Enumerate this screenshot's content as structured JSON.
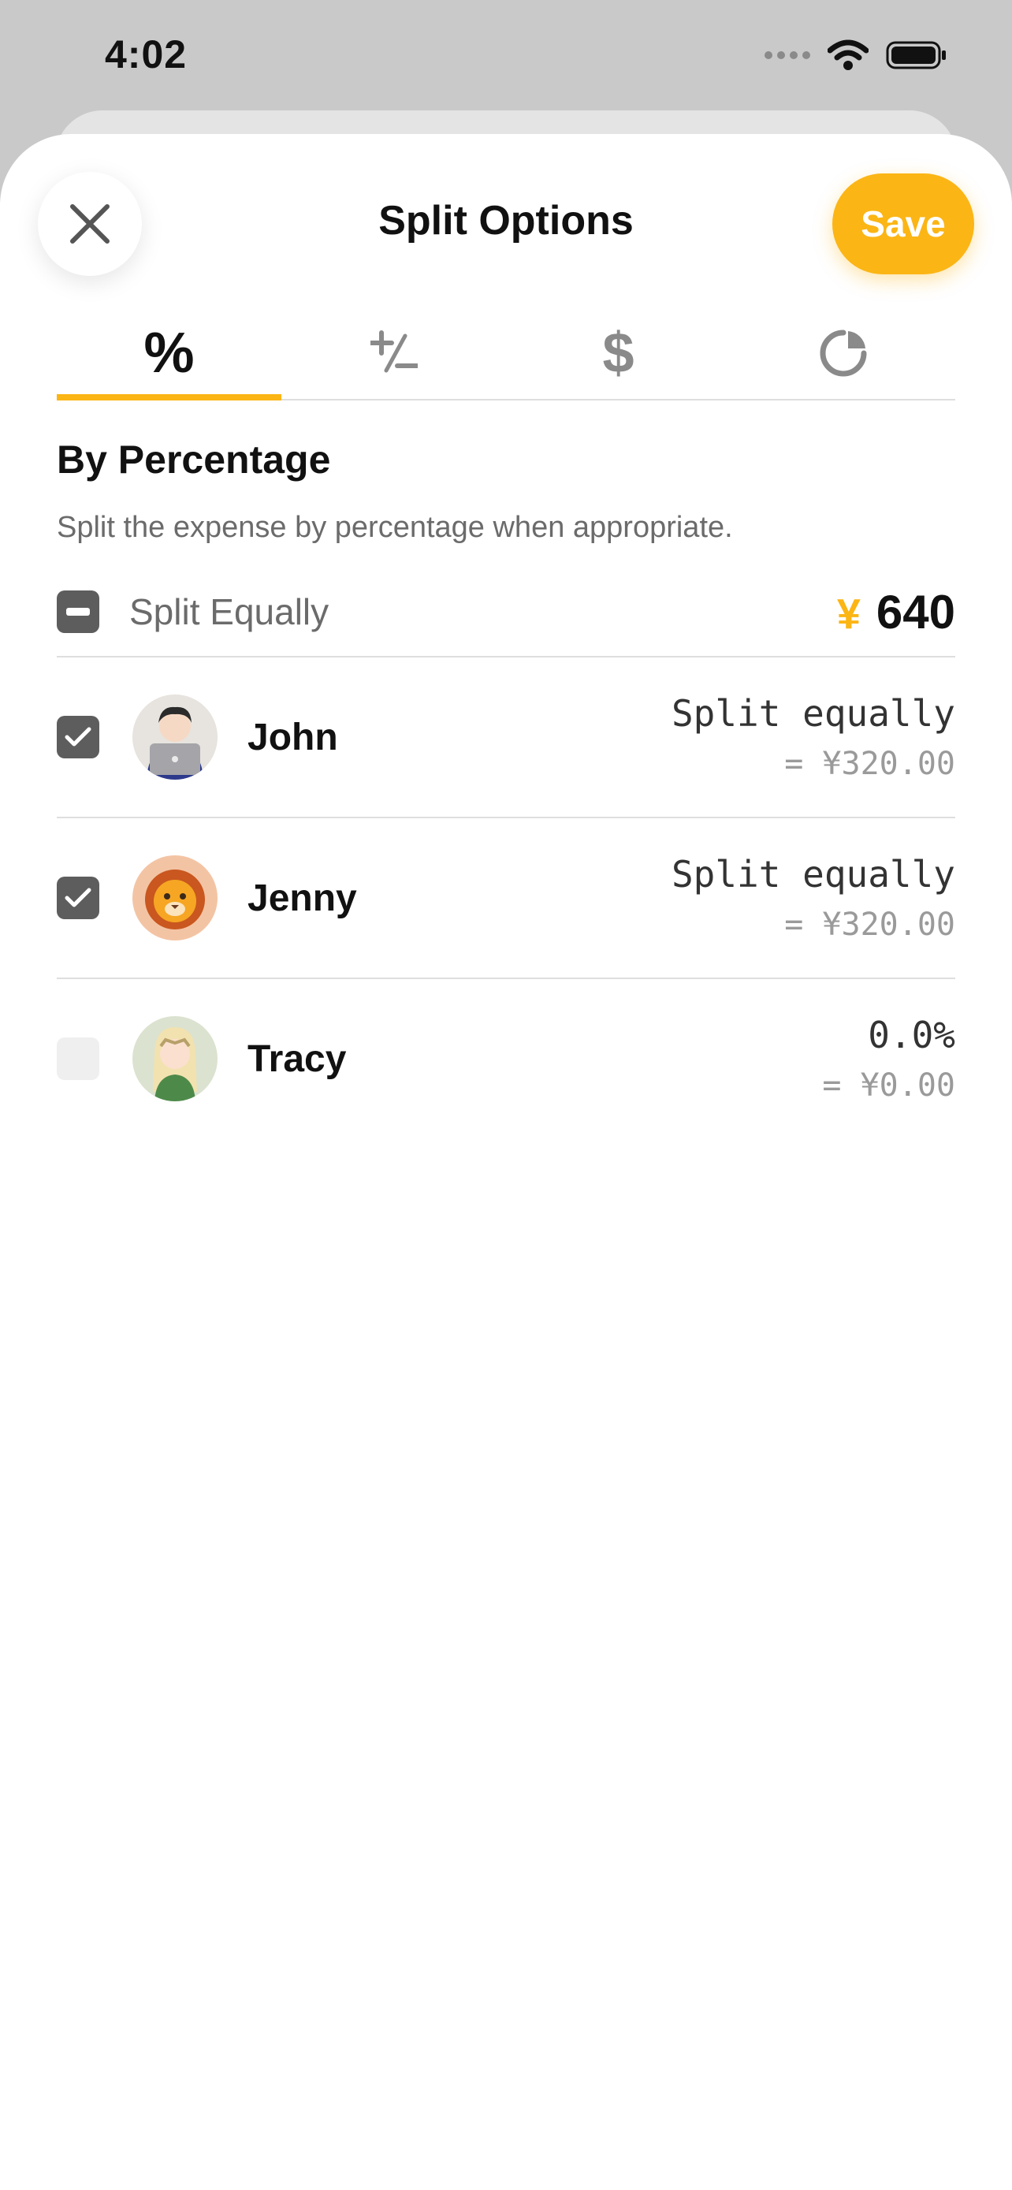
{
  "status_bar": {
    "time": "4:02"
  },
  "header": {
    "title": "Split Options",
    "save_label": "Save"
  },
  "tabs": [
    {
      "label": "%",
      "name": "percent"
    },
    {
      "label": "+/−",
      "name": "plus-minus"
    },
    {
      "label": "$",
      "name": "dollar"
    },
    {
      "label": "",
      "name": "pie"
    }
  ],
  "section": {
    "title": "By Percentage",
    "description": "Split the expense by percentage when appropriate."
  },
  "split_all": {
    "label": "Split Equally",
    "currency": "¥",
    "amount": "640"
  },
  "people": [
    {
      "name": "John",
      "primary": "Split equally",
      "secondary": "= ¥320.00",
      "checked": true
    },
    {
      "name": "Jenny",
      "primary": "Split equally",
      "secondary": "= ¥320.00",
      "checked": true
    },
    {
      "name": "Tracy",
      "primary": "0.0%",
      "secondary": "= ¥0.00",
      "checked": false
    }
  ],
  "colors": {
    "accent": "#fbb515",
    "checkbox": "#5d5d5d",
    "divider": "#dedede"
  }
}
